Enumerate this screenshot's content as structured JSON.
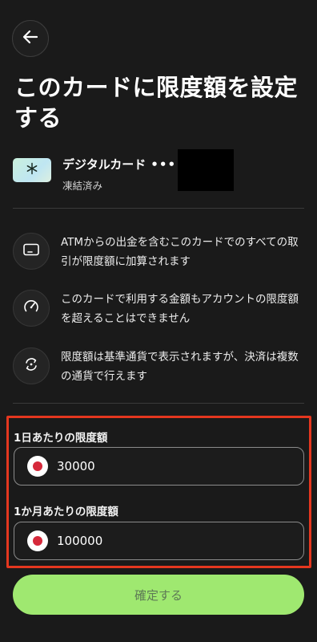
{
  "header": {
    "back_icon": "arrow-left-icon",
    "title": "このカードに限度額を設定する"
  },
  "card": {
    "icon": "snowflake-icon",
    "name": "デジタルカード",
    "masked_number": "••••",
    "status": "凍結済み"
  },
  "info": [
    {
      "icon": "card-outline-icon",
      "text": "ATMからの出金を含むこのカードでのすべての取引が限度額に加算されます"
    },
    {
      "icon": "speedometer-icon",
      "text": "このカードで利用する金額もアカウントの限度額を超えることはできません"
    },
    {
      "icon": "currency-exchange-icon",
      "text": "限度額は基準通貨で表示されますが、決済は複数の通貨で行えます"
    }
  ],
  "limits": {
    "daily_label": "1日あたりの限度額",
    "daily_value": "30000",
    "monthly_label": "1か月あたりの限度額",
    "monthly_value": "100000",
    "currency_flag_icon": "japan-flag-icon"
  },
  "footer": {
    "confirm_label": "確定する"
  },
  "colors": {
    "background": "#1a1a1a",
    "accent_button": "#9fe870",
    "highlight_border": "#e4371f",
    "flag_red": "#d6293b"
  }
}
